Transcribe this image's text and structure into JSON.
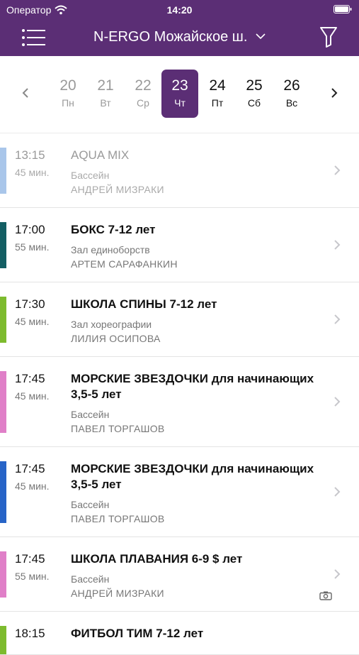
{
  "status_bar": {
    "carrier": "Оператор",
    "time": "14:20"
  },
  "header": {
    "title": "N-ERGO Можайское ш."
  },
  "colors": {
    "header_bg": "#5b2e75",
    "selected_day": "#5b2e75"
  },
  "days": [
    {
      "num": "20",
      "weekday": "Пн",
      "state": "past"
    },
    {
      "num": "21",
      "weekday": "Вт",
      "state": "past"
    },
    {
      "num": "22",
      "weekday": "Ср",
      "state": "past"
    },
    {
      "num": "23",
      "weekday": "Чт",
      "state": "selected"
    },
    {
      "num": "24",
      "weekday": "Пт",
      "state": "future"
    },
    {
      "num": "25",
      "weekday": "Сб",
      "state": "future"
    },
    {
      "num": "26",
      "weekday": "Вс",
      "state": "future"
    }
  ],
  "classes": [
    {
      "time": "13:15",
      "duration": "45 мин.",
      "name": "AQUA MIX",
      "room": "Бассейн",
      "coach": "АНДРЕЙ МИЗРАКИ",
      "color": "#a9c6ea",
      "past": true
    },
    {
      "time": "17:00",
      "duration": "55 мин.",
      "name": "БОКС 7-12 лет",
      "room": "Зал единоборств",
      "coach": "АРТЕМ САРАФАНКИН",
      "color": "#135e63",
      "past": false
    },
    {
      "time": "17:30",
      "duration": "45 мин.",
      "name": "ШКОЛА СПИНЫ 7-12 лет",
      "room": "Зал хореографии",
      "coach": "ЛИЛИЯ ОСИПОВА",
      "color": "#7dbb2e",
      "past": false
    },
    {
      "time": "17:45",
      "duration": "45 мин.",
      "name": "МОРСКИЕ ЗВЕЗДОЧКИ для начинающих 3,5-5 лет",
      "room": "Бассейн",
      "coach": "ПАВЕЛ ТОРГАШОВ",
      "color": "#e07fc8",
      "past": false
    },
    {
      "time": "17:45",
      "duration": "45 мин.",
      "name": "МОРСКИЕ ЗВЕЗДОЧКИ для начинающих 3,5-5 лет",
      "room": "Бассейн",
      "coach": "ПАВЕЛ ТОРГАШОВ",
      "color": "#2764c7",
      "past": false
    },
    {
      "time": "17:45",
      "duration": "55 мин.",
      "name": "ШКОЛА ПЛАВАНИЯ 6-9 $ лет",
      "room": "Бассейн",
      "coach": "АНДРЕЙ МИЗРАКИ",
      "color": "#e07fc8",
      "past": false,
      "camera_icon": "camera-icon"
    },
    {
      "time": "18:15",
      "duration": "",
      "name": "ФИТБОЛ ТИМ 7-12 лет",
      "room": "",
      "coach": "",
      "color": "#7dbb2e",
      "past": false
    }
  ]
}
